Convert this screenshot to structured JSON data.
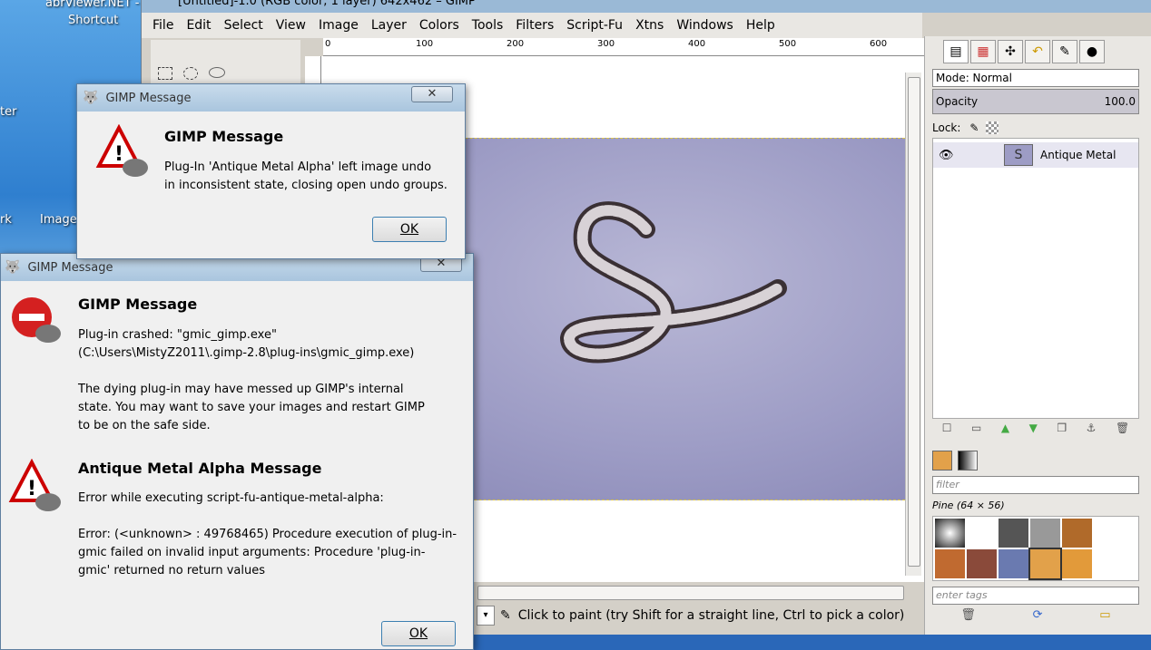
{
  "desktop": {
    "icon_labels": [
      "abrViewer.NET -",
      "Shortcut",
      "ter",
      "rk",
      "Image"
    ]
  },
  "gimp": {
    "window_title": "[Untitled]-1.0 (RGB color, 1 layer) 642x462 – GIMP",
    "menu": [
      "File",
      "Edit",
      "Select",
      "View",
      "Image",
      "Layer",
      "Colors",
      "Tools",
      "Filters",
      "Script-Fu",
      "Xtns",
      "Windows",
      "Help"
    ],
    "ruler_ticks": [
      "0",
      "100",
      "200",
      "300",
      "400",
      "500",
      "600"
    ],
    "status_text": "Click to paint (try Shift for a straight line, Ctrl to pick a color)"
  },
  "layers_dock": {
    "mode_label": "Mode: Normal",
    "opacity_label": "Opacity",
    "opacity_value": "100.0",
    "lock_label": "Lock:",
    "layer_name": "Antique Metal"
  },
  "patterns_dock": {
    "filter_placeholder": "filter",
    "pattern_name": "Pine (64 × 56)",
    "tags_placeholder": "enter tags"
  },
  "dialog1": {
    "title": "GIMP Message",
    "heading": "GIMP Message",
    "text": "Plug-In 'Antique Metal Alpha' left image undo\nin inconsistent state, closing open undo groups.",
    "ok_label": "OK"
  },
  "dialog2": {
    "title": "GIMP Message",
    "heading1": "GIMP Message",
    "text1": "Plug-in crashed: \"gmic_gimp.exe\"\n(C:\\Users\\MistyZ2011\\.gimp-2.8\\plug-ins\\gmic_gimp.exe)\n\nThe dying plug-in may have messed up GIMP's internal\nstate. You may want to save your images and restart GIMP\nto be on the safe side.",
    "heading2": "Antique Metal Alpha Message",
    "text2": "Error while executing script-fu-antique-metal-alpha:\n\nError: (<unknown> : 49768465) Procedure execution of plug-in-\ngmic failed on invalid input arguments: Procedure 'plug-in-\ngmic' returned no return values",
    "ok_label": "OK"
  },
  "colors": {
    "image_bg": "#9d9cc5",
    "dialog_bg": "#f0f0f0",
    "titlebar": "#b3cce3"
  }
}
